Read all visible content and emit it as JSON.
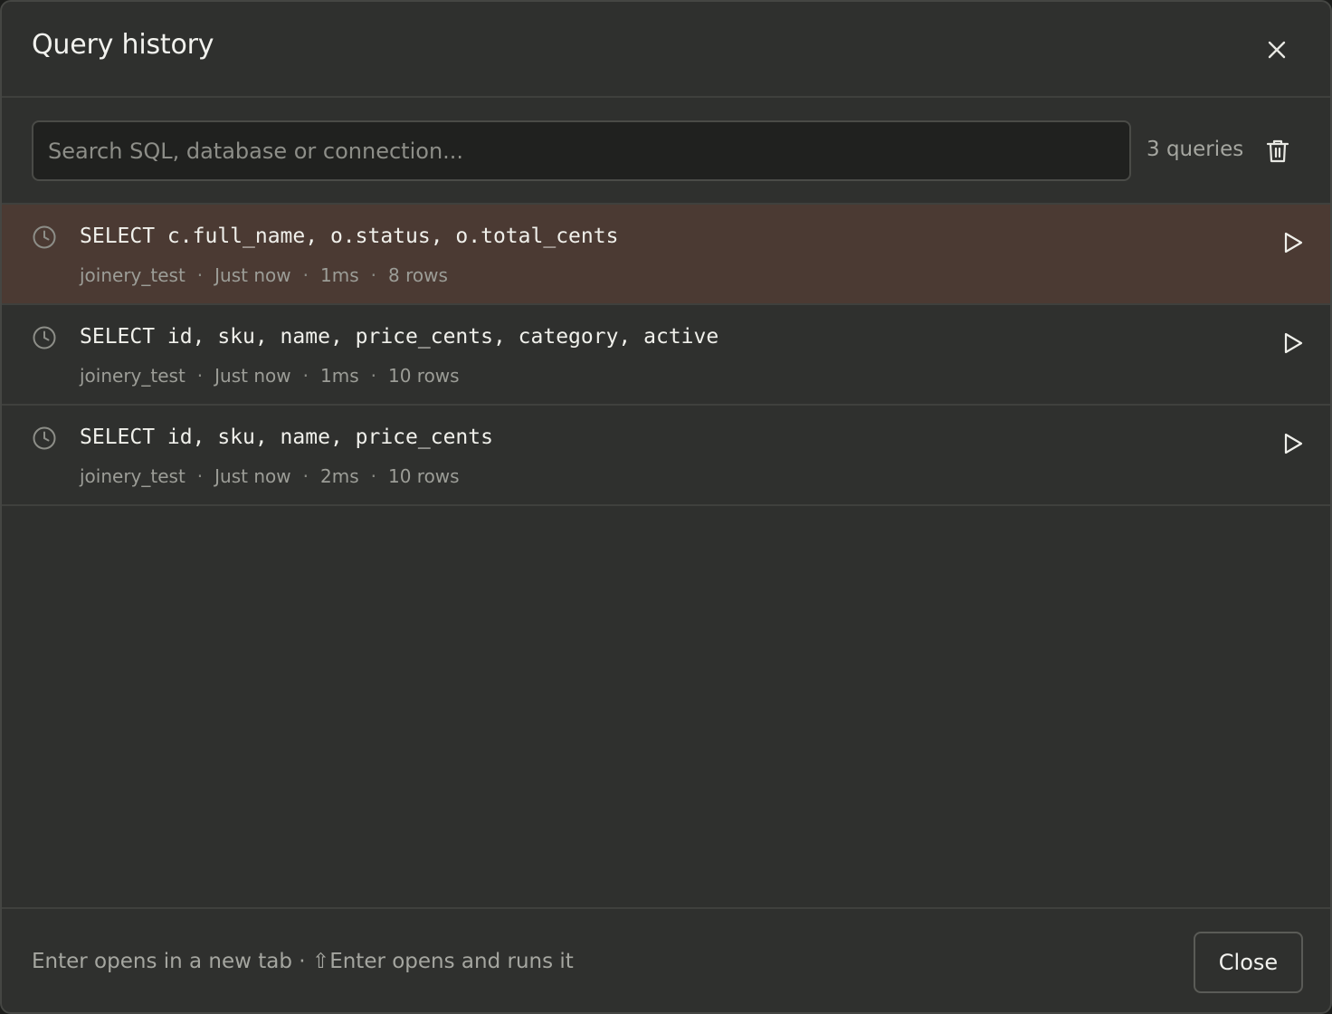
{
  "dialog": {
    "title": "Query history",
    "close_icon": "close-icon"
  },
  "toolbar": {
    "search_placeholder": "Search SQL, database or connection...",
    "search_value": "",
    "count_label": "3 queries",
    "trash_icon": "trash-icon"
  },
  "queries": [
    {
      "sql": "SELECT c.full_name, o.status, o.total_cents",
      "database": "joinery_test",
      "time": "Just now",
      "duration": "1ms",
      "rows": "8 rows",
      "selected": true
    },
    {
      "sql": "SELECT id, sku, name, price_cents, category, active",
      "database": "joinery_test",
      "time": "Just now",
      "duration": "1ms",
      "rows": "10 rows",
      "selected": false
    },
    {
      "sql": "SELECT id, sku, name, price_cents",
      "database": "joinery_test",
      "time": "Just now",
      "duration": "2ms",
      "rows": "10 rows",
      "selected": false
    }
  ],
  "footer": {
    "hint": "Enter opens in a new tab · ⇧Enter opens and runs it",
    "close_label": "Close"
  },
  "colors": {
    "background": "#2f302e",
    "selected_row": "#4b3a33",
    "text": "#f0f0eb",
    "muted": "#9c9d97"
  }
}
